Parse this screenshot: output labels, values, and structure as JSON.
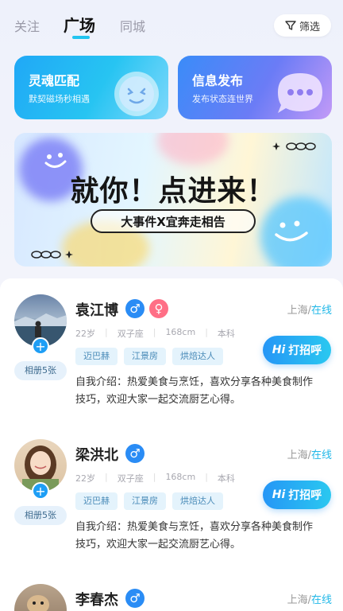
{
  "tabs": [
    {
      "label": "关注"
    },
    {
      "label": "广场"
    },
    {
      "label": "同城"
    }
  ],
  "filter": {
    "label": "筛选"
  },
  "cards": [
    {
      "title": "灵魂匹配",
      "subtitle": "默契磁场秒相遇"
    },
    {
      "title": "信息发布",
      "subtitle": "发布状态连世界"
    }
  ],
  "banner": {
    "title": "就你！点进来！",
    "subtitle": "大事件X宜奔走相告"
  },
  "users": [
    {
      "name": "袁江博",
      "genders": [
        "male",
        "female"
      ],
      "city": "上海",
      "status": "在线",
      "age": "22岁",
      "zodiac": "双子座",
      "height": "168cm",
      "education": "本科",
      "tags": [
        "迈巴赫",
        "江景房",
        "烘焙达人"
      ],
      "album": "相册5张",
      "greet": "打招呼",
      "intro_line1": "自我介绍：热爱美食与烹饪，喜欢分享各种美食制作",
      "intro_line2": "技巧，欢迎大家一起交流厨艺心得。"
    },
    {
      "name": "梁洪北",
      "genders": [
        "male"
      ],
      "city": "上海",
      "status": "在线",
      "age": "22岁",
      "zodiac": "双子座",
      "height": "168cm",
      "education": "本科",
      "tags": [
        "迈巴赫",
        "江景房",
        "烘焙达人"
      ],
      "album": "相册5张",
      "greet": "打招呼",
      "intro_line1": "自我介绍：热爱美食与烹饪，喜欢分享各种美食制作",
      "intro_line2": "技巧，欢迎大家一起交流厨艺心得。"
    },
    {
      "name": "李春杰",
      "genders": [
        "male"
      ],
      "city": "上海",
      "status": "在线"
    }
  ],
  "greet_prefix": "Hi",
  "separator": "/",
  "gender_symbols": {
    "male": "♂",
    "female": "♀"
  },
  "colors": {
    "accent": "#22c4f0",
    "male": "#2a8cf5",
    "female": "#ff6f86",
    "online": "#22b8e8"
  }
}
